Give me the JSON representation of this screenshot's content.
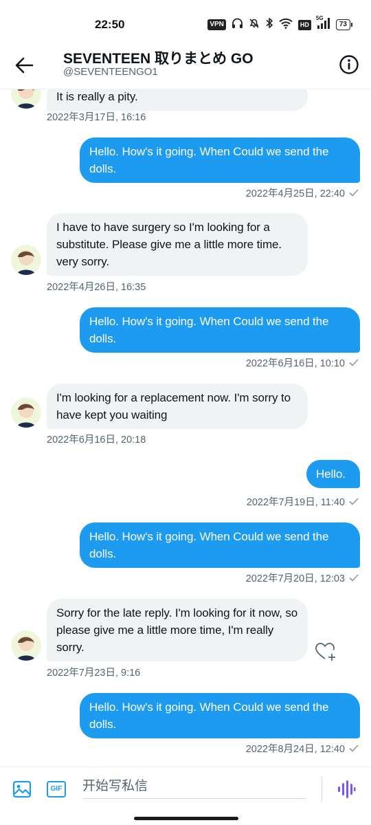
{
  "status_bar": {
    "time": "22:50",
    "vpn": "VPN",
    "hd": "HD",
    "network": "5G",
    "battery": "73",
    "icons": [
      "headphones-icon",
      "mute-icon",
      "bluetooth-icon",
      "wifi-icon",
      "signal-icon"
    ]
  },
  "header": {
    "title": "SEVENTEEN 取りまとめ GO",
    "handle": "@SEVENTEENGO1",
    "back_icon": "back-arrow-icon",
    "info_icon": "info-icon"
  },
  "messages": [
    {
      "direction": "in",
      "text": "It is really a pity.",
      "time": "2022年3月17日, 16:16"
    },
    {
      "direction": "out",
      "text": "Hello. How's it going. When Could we send the dolls.",
      "time": "2022年4月25日, 22:40"
    },
    {
      "direction": "in",
      "text": "I have to have surgery so I'm looking for a substitute.  Please give me a little more time.  very sorry.",
      "time": "2022年4月26日, 16:35"
    },
    {
      "direction": "out",
      "text": "Hello. How's it going. When Could we send the dolls.",
      "time": "2022年6月16日, 10:10"
    },
    {
      "direction": "in",
      "text": "I'm looking for a replacement now.  I'm sorry to have kept you waiting",
      "time": "2022年6月16日, 20:18"
    },
    {
      "direction": "out",
      "text": "Hello.",
      "time": "2022年7月19日, 11:40"
    },
    {
      "direction": "out",
      "text": "Hello. How's it going. When Could we send the dolls.",
      "time": "2022年7月20日, 12:03"
    },
    {
      "direction": "in",
      "text": "Sorry for the late reply.  I'm looking for it now, so please give me a little more time, I'm really sorry.",
      "time": "2022年7月23日, 9:16"
    },
    {
      "direction": "out",
      "text": "Hello. How's it going. When Could we send the dolls.",
      "time": "2022年8月24日, 12:40"
    }
  ],
  "composer": {
    "placeholder": "开始写私信",
    "gif_label": "GIF",
    "media_icon": "image-icon",
    "voice_icon": "voice-wave-icon"
  },
  "colors": {
    "accent": "#1d9bf0",
    "incoming_bubble": "#eff3f4",
    "muted_text": "#536471",
    "voice": "#7856ff"
  }
}
